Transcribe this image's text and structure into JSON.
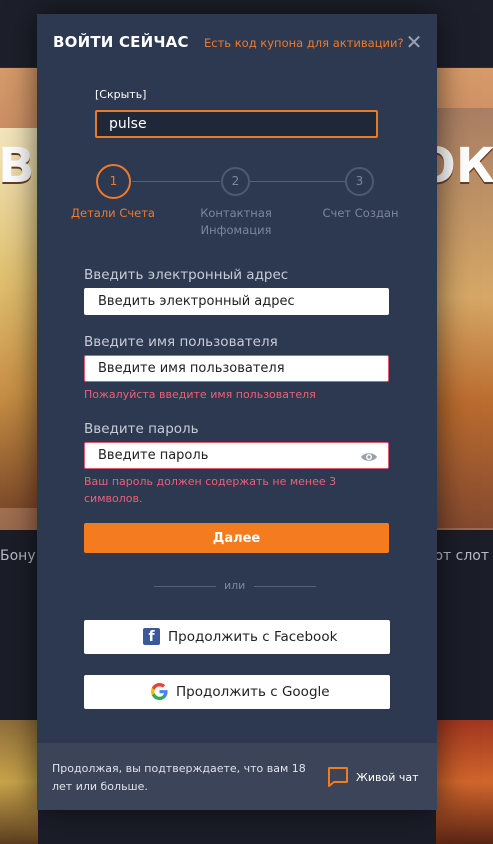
{
  "background": {
    "left_banner_text": "В",
    "right_banner_text": "ОК",
    "left_caption": "Бону",
    "right_caption": "пот слот"
  },
  "modal": {
    "title": "ВОЙТИ СЕЙЧАС",
    "coupon_link": "Есть код купона для активации?",
    "close_icon": "close-icon",
    "hide_link": "[Скрыть]",
    "coupon_value": "pulse"
  },
  "steps": [
    {
      "number": "1",
      "label": "Детали Счета",
      "active": true
    },
    {
      "number": "2",
      "label": "Контактная Инфомация",
      "active": false
    },
    {
      "number": "3",
      "label": "Счет Создан",
      "active": false
    }
  ],
  "form": {
    "email_label": "Введить электронный адрес",
    "email_placeholder": "Введить электронный адрес",
    "username_label": "Введите имя пользователя",
    "username_placeholder": "Введите имя пользователя",
    "username_error": "Пожалуйста введите имя пользователя",
    "password_label": "Введите пароль",
    "password_placeholder": "Введите пароль",
    "password_error": "Ваш пароль должен содержать не менее 3 символов.",
    "next_button": "Далее"
  },
  "divider_text": "или",
  "social": {
    "facebook_label": "Продолжить с Facebook",
    "google_label": "Продолжить с Google"
  },
  "footer": {
    "disclaimer": "Продолжая, вы подтверждаете, что вам 18 лет или больше.",
    "chat_label": "Живой чат"
  },
  "colors": {
    "accent": "#f47b1e",
    "modal_bg": "#2d3950",
    "error": "#ee5f79",
    "facebook": "#3b5998"
  }
}
